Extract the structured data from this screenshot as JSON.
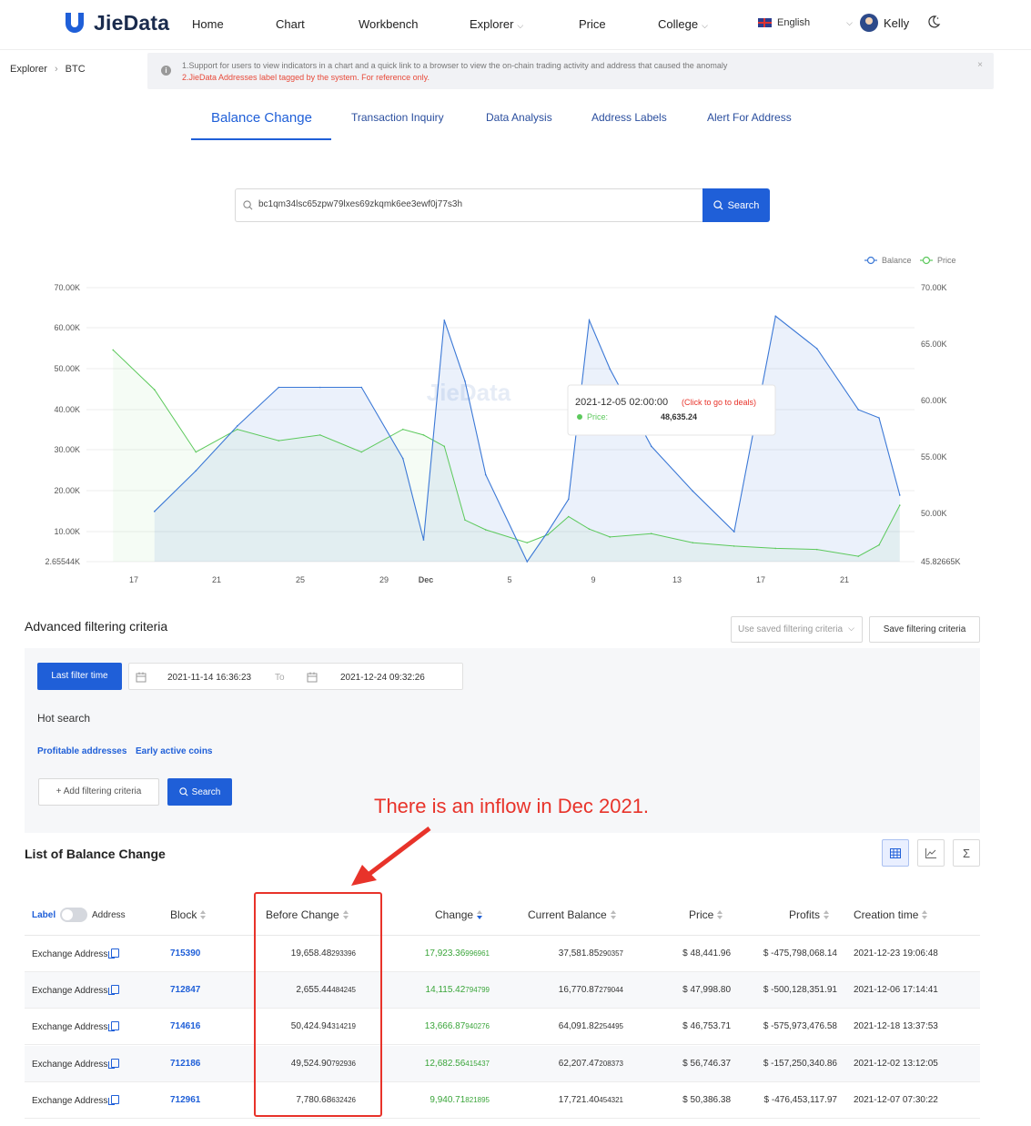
{
  "brand": {
    "name": "JieData",
    "color": "#1f5fd8"
  },
  "nav": {
    "home": "Home",
    "chart": "Chart",
    "workbench": "Workbench",
    "explorer": "Explorer",
    "price": "Price",
    "college": "College",
    "language": "English",
    "user": "Kelly"
  },
  "breadcrumb": {
    "root": "Explorer",
    "current": "BTC"
  },
  "notice": {
    "line1": "1.Support for users to view indicators in a chart and a quick link to a browser to view the on-chain trading activity and address that caused the anomaly",
    "line2": "2.JieData Addresses label tagged by the system. For reference only.",
    "close": "×"
  },
  "tabs": [
    "Balance Change",
    "Transaction Inquiry",
    "Data Analysis",
    "Address Labels",
    "Alert For Address"
  ],
  "search": {
    "value": "bc1qm34lsc65zpw79lxes69zkqmk6ee3ewf0j77s3h",
    "button": "Search"
  },
  "chart_data": {
    "type": "line",
    "legend": [
      "Balance",
      "Price"
    ],
    "legend_position": "top-right",
    "watermark": "JieData",
    "x_ticks": [
      "17",
      "21",
      "25",
      "29",
      "Dec",
      "5",
      "9",
      "13",
      "17",
      "21"
    ],
    "y_left_ticks": [
      "70.00K",
      "60.00K",
      "50.00K",
      "40.00K",
      "30.00K",
      "20.00K",
      "10.00K",
      "2.65544K"
    ],
    "y_right_ticks": [
      "70.00K",
      "65.00K",
      "60.00K",
      "55.00K",
      "50.00K",
      "45.82665K"
    ],
    "y_left_range": [
      2655.44,
      70000
    ],
    "y_right_range": [
      45826.65,
      70000
    ],
    "x": [
      "2021-11-16",
      "2021-11-18",
      "2021-11-20",
      "2021-11-22",
      "2021-11-24",
      "2021-11-26",
      "2021-11-28",
      "2021-11-30",
      "2021-12-01",
      "2021-12-02",
      "2021-12-03",
      "2021-12-04",
      "2021-12-06",
      "2021-12-07",
      "2021-12-08",
      "2021-12-09",
      "2021-12-10",
      "2021-12-12",
      "2021-12-14",
      "2021-12-16",
      "2021-12-18",
      "2021-12-20",
      "2021-12-22",
      "2021-12-23",
      "2021-12-24"
    ],
    "series": [
      {
        "name": "Balance",
        "color": "#3b78d6",
        "values": [
          null,
          15000,
          25000,
          36000,
          45500,
          45500,
          45500,
          28000,
          8000,
          62000,
          47000,
          24000,
          2655,
          10000,
          18000,
          62000,
          50000,
          31000,
          20000,
          10000,
          63000,
          55000,
          40000,
          38000,
          19000
        ]
      },
      {
        "name": "Price",
        "color": "#5cc95c",
        "values": [
          64500,
          61000,
          55500,
          57500,
          56500,
          57000,
          55500,
          57500,
          57000,
          56000,
          49500,
          48635.24,
          47500,
          48200,
          49800,
          48700,
          48000,
          48300,
          47500,
          47200,
          47000,
          46900,
          46300,
          47300,
          50800
        ]
      }
    ],
    "tooltip": {
      "date": "2021-12-05 02:00:00",
      "link": "(Click to go to deals)",
      "label": "Price:",
      "value": "48,635.24"
    }
  },
  "filters": {
    "title": "Advanced filtering criteria",
    "saved_placeholder": "Use saved filtering criteria",
    "save_button": "Save filtering criteria",
    "last_filter_button": "Last filter time",
    "date_from": "2021-11-14 16:36:23",
    "date_to_label": "To",
    "date_to": "2021-12-24 09:32:26",
    "hot_title": "Hot search",
    "hot_links": [
      "Profitable addresses",
      "Early active coins"
    ],
    "add_button": "+ Add filtering criteria",
    "search_button": "Search"
  },
  "annotation": "There is an inflow in Dec 2021.",
  "table": {
    "title": "List of Balance Change",
    "columns": {
      "label": "Label",
      "address": "Address",
      "block": "Block",
      "before": "Before Change",
      "change": "Change",
      "current": "Current Balance",
      "price": "Price",
      "profits": "Profits",
      "created": "Creation time"
    },
    "rows": [
      {
        "label": "Exchange Address",
        "block": "715390",
        "before_main": "19,658.48",
        "before_tail": "293396",
        "change_main": "17,923.36",
        "change_tail": "996961",
        "current_main": "37,581.85",
        "current_tail": "290357",
        "price": "$ 48,441.96",
        "profits": "$ -475,798,068.14",
        "created": "2021-12-23 19:06:48"
      },
      {
        "label": "Exchange Address",
        "block": "712847",
        "before_main": "2,655.44",
        "before_tail": "484245",
        "change_main": "14,115.42",
        "change_tail": "794799",
        "current_main": "16,770.87",
        "current_tail": "279044",
        "price": "$ 47,998.80",
        "profits": "$ -500,128,351.91",
        "created": "2021-12-06 17:14:41"
      },
      {
        "label": "Exchange Address",
        "block": "714616",
        "before_main": "50,424.94",
        "before_tail": "314219",
        "change_main": "13,666.87",
        "change_tail": "940276",
        "current_main": "64,091.82",
        "current_tail": "254495",
        "price": "$ 46,753.71",
        "profits": "$ -575,973,476.58",
        "created": "2021-12-18 13:37:53"
      },
      {
        "label": "Exchange Address",
        "block": "712186",
        "before_main": "49,524.90",
        "before_tail": "792936",
        "change_main": "12,682.56",
        "change_tail": "415437",
        "current_main": "62,207.47",
        "current_tail": "208373",
        "price": "$ 56,746.37",
        "profits": "$ -157,250,340.86",
        "created": "2021-12-02 13:12:05"
      },
      {
        "label": "Exchange Address",
        "block": "712961",
        "before_main": "7,780.68",
        "before_tail": "632426",
        "change_main": "9,940.71",
        "change_tail": "821895",
        "current_main": "17,721.40",
        "current_tail": "454321",
        "price": "$ 50,386.38",
        "profits": "$ -476,453,117.97",
        "created": "2021-12-07 07:30:22"
      }
    ]
  }
}
